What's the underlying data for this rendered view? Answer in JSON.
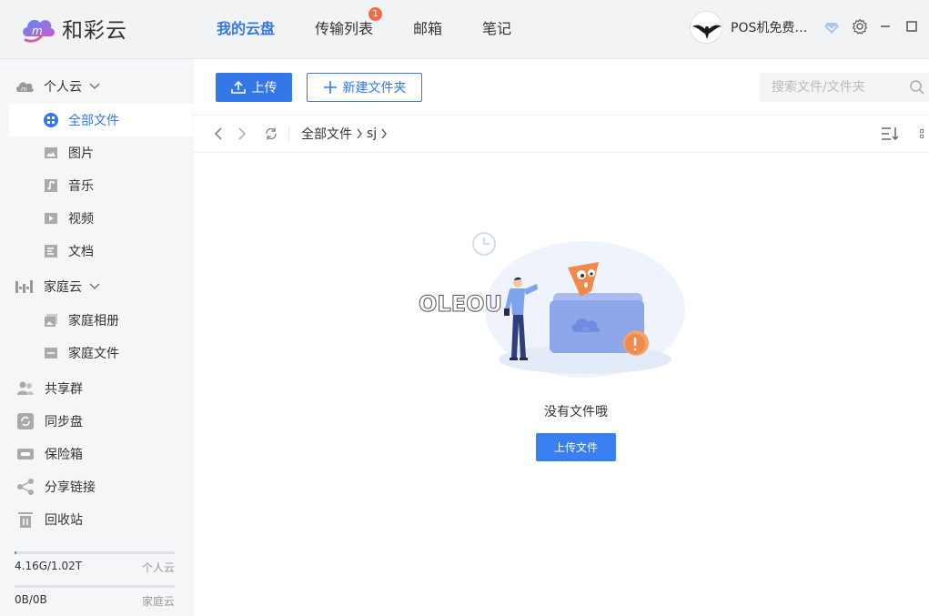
{
  "app": {
    "name": "和彩云"
  },
  "nav": {
    "items": [
      {
        "label": "我的云盘",
        "active": true
      },
      {
        "label": "传输列表",
        "badge": "1"
      },
      {
        "label": "邮箱"
      },
      {
        "label": "笔记"
      }
    ]
  },
  "user": {
    "name": "POS机免费申请..."
  },
  "sidebar": {
    "personal": {
      "label": "个人云"
    },
    "personal_items": [
      {
        "label": "全部文件",
        "icon": "grid-icon",
        "active": true
      },
      {
        "label": "图片",
        "icon": "image-icon"
      },
      {
        "label": "音乐",
        "icon": "music-icon"
      },
      {
        "label": "视频",
        "icon": "video-icon"
      },
      {
        "label": "文档",
        "icon": "document-icon"
      }
    ],
    "family": {
      "label": "家庭云"
    },
    "family_items": [
      {
        "label": "家庭相册",
        "icon": "album-icon"
      },
      {
        "label": "家庭文件",
        "icon": "folder-icon"
      }
    ],
    "top_items": [
      {
        "label": "共享群",
        "icon": "group-icon"
      },
      {
        "label": "同步盘",
        "icon": "sync-icon"
      },
      {
        "label": "保险箱",
        "icon": "safe-icon"
      },
      {
        "label": "分享链接",
        "icon": "share-icon"
      },
      {
        "label": "回收站",
        "icon": "trash-icon"
      }
    ],
    "quota": [
      {
        "used": "4.16G/1.02T",
        "kind": "个人云",
        "fraction": 0.004
      },
      {
        "used": "0B/0B",
        "kind": "家庭云",
        "fraction": 0
      }
    ]
  },
  "toolbar": {
    "upload_label": "上传",
    "new_folder_label": "新建文件夹",
    "search_placeholder": "搜索文件/文件夹"
  },
  "breadcrumb": [
    "全部文件",
    "sj"
  ],
  "empty": {
    "watermark": "OLEOU",
    "message": "没有文件哦",
    "upload_label": "上传文件"
  },
  "colors": {
    "accent": "#3477e8",
    "badge": "#f06a4c"
  }
}
